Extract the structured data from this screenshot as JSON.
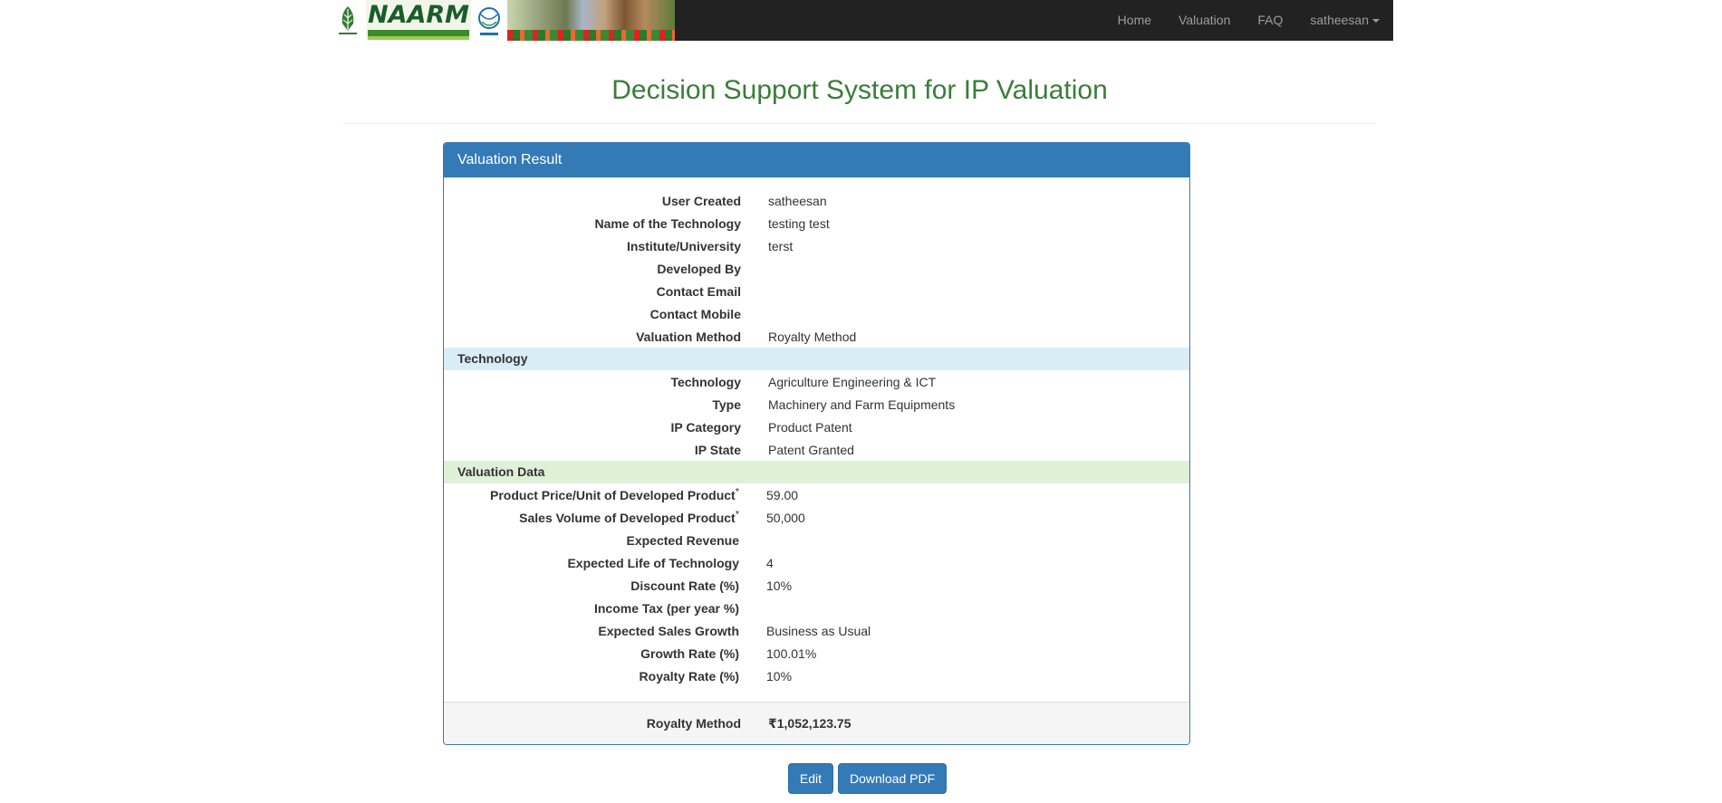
{
  "nav": {
    "brand_text": "NAARM",
    "items": [
      {
        "label": "Home"
      },
      {
        "label": "Valuation"
      },
      {
        "label": "FAQ"
      },
      {
        "label": "satheesan"
      }
    ]
  },
  "page": {
    "title": "Decision Support System for IP Valuation"
  },
  "panel": {
    "heading": "Valuation Result",
    "general": [
      {
        "label": "User Created",
        "value": "satheesan"
      },
      {
        "label": "Name of the Technology",
        "value": "testing test"
      },
      {
        "label": "Institute/University",
        "value": "terst"
      },
      {
        "label": "Developed By",
        "value": ""
      },
      {
        "label": "Contact Email",
        "value": ""
      },
      {
        "label": "Contact Mobile",
        "value": ""
      },
      {
        "label": "Valuation Method",
        "value": "Royalty Method"
      }
    ],
    "technology_section": "Technology",
    "technology": [
      {
        "label": "Technology",
        "value": "Agriculture Engineering & ICT"
      },
      {
        "label": "Type",
        "value": "Machinery and Farm Equipments"
      },
      {
        "label": "IP Category",
        "value": "Product Patent"
      },
      {
        "label": "IP State",
        "value": "Patent Granted"
      }
    ],
    "valuation_section": "Valuation Data",
    "valuation": [
      {
        "label": "Product Price/Unit of Developed Product",
        "required": "*",
        "value": "59.00"
      },
      {
        "label": "Sales Volume of Developed Product",
        "required": "*",
        "value": "50,000"
      },
      {
        "label": "Expected Revenue",
        "required": "",
        "value": ""
      },
      {
        "label": "Expected Life of Technology",
        "required": "",
        "value": "4"
      },
      {
        "label": "Discount Rate (%)",
        "required": "",
        "value": "10%"
      },
      {
        "label": "Income Tax (per year %)",
        "required": "",
        "value": ""
      },
      {
        "label": "Expected Sales Growth",
        "required": "",
        "value": "Business as Usual"
      },
      {
        "label": "Growth Rate (%)",
        "required": "",
        "value": "100.01%"
      },
      {
        "label": "Royalty Rate (%)",
        "required": "",
        "value": "10%"
      }
    ],
    "footer": {
      "label": "Royalty Method",
      "value": "₹1,052,123.75"
    }
  },
  "buttons": {
    "edit": "Edit",
    "download": "Download PDF"
  },
  "colors": {
    "navbar": "#222222",
    "primary": "#337ab7",
    "title_green": "#3a7d3a",
    "info_row": "#d9edf7",
    "success_row": "#dff0d8"
  }
}
